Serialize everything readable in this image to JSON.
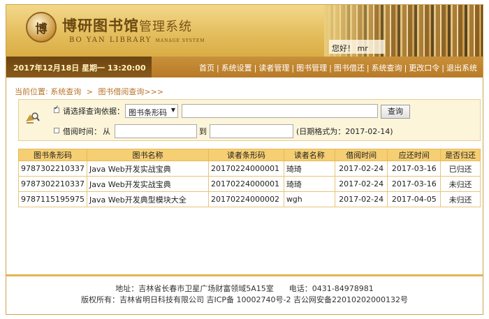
{
  "header": {
    "logo_char": "博",
    "title_main": "博研图书馆",
    "title_sub": "管理系统",
    "title_en": "BO YAN LIBRARY",
    "title_en_small": "MANAGE SYSTEM",
    "greeting": "您好！ mr"
  },
  "navbar": {
    "datetime": "2017年12月18日 星期一 13:20:00",
    "items": [
      {
        "label": "首页"
      },
      {
        "label": "系统设置"
      },
      {
        "label": "读者管理"
      },
      {
        "label": "图书管理"
      },
      {
        "label": "图书借还"
      },
      {
        "label": "系统查询"
      },
      {
        "label": "更改口令"
      },
      {
        "label": "退出系统"
      }
    ],
    "separator": "|"
  },
  "breadcrumb": {
    "prefix": "当前位置:",
    "level1": "系统查询",
    "arrow": ">",
    "level2": "图书借阅查询>>>"
  },
  "query": {
    "criteria_label": "请选择查询依据：",
    "criteria_selected": "图书条形码",
    "search_button": "查询",
    "date_label": "借阅时间：",
    "from_label": "从",
    "to_label": "到",
    "date_hint": "(日期格式为：2017-02-14)"
  },
  "table": {
    "columns": [
      "图书条形码",
      "图书名称",
      "读者条形码",
      "读者名称",
      "借阅时间",
      "应还时间",
      "是否归还"
    ],
    "rows": [
      [
        "9787302210337",
        "Java Web开发实战宝典",
        "20170224000001",
        "琦琦",
        "2017-02-24",
        "2017-03-16",
        "已归还"
      ],
      [
        "9787302210337",
        "Java Web开发实战宝典",
        "20170224000001",
        "琦琦",
        "2017-02-24",
        "2017-03-16",
        "未归还"
      ],
      [
        "9787115195975",
        "Java Web开发典型模块大全",
        "20170224000002",
        "wgh",
        "2017-02-24",
        "2017-04-05",
        "未归还"
      ]
    ]
  },
  "footer": {
    "address": "地址：吉林省长春市卫星广场财富领域5A15室　　电话：0431-84978981",
    "copyright": "版权所有：吉林省明日科技有限公司 吉ICP备 10002740号-2 吉公网安备22010202000132号"
  }
}
